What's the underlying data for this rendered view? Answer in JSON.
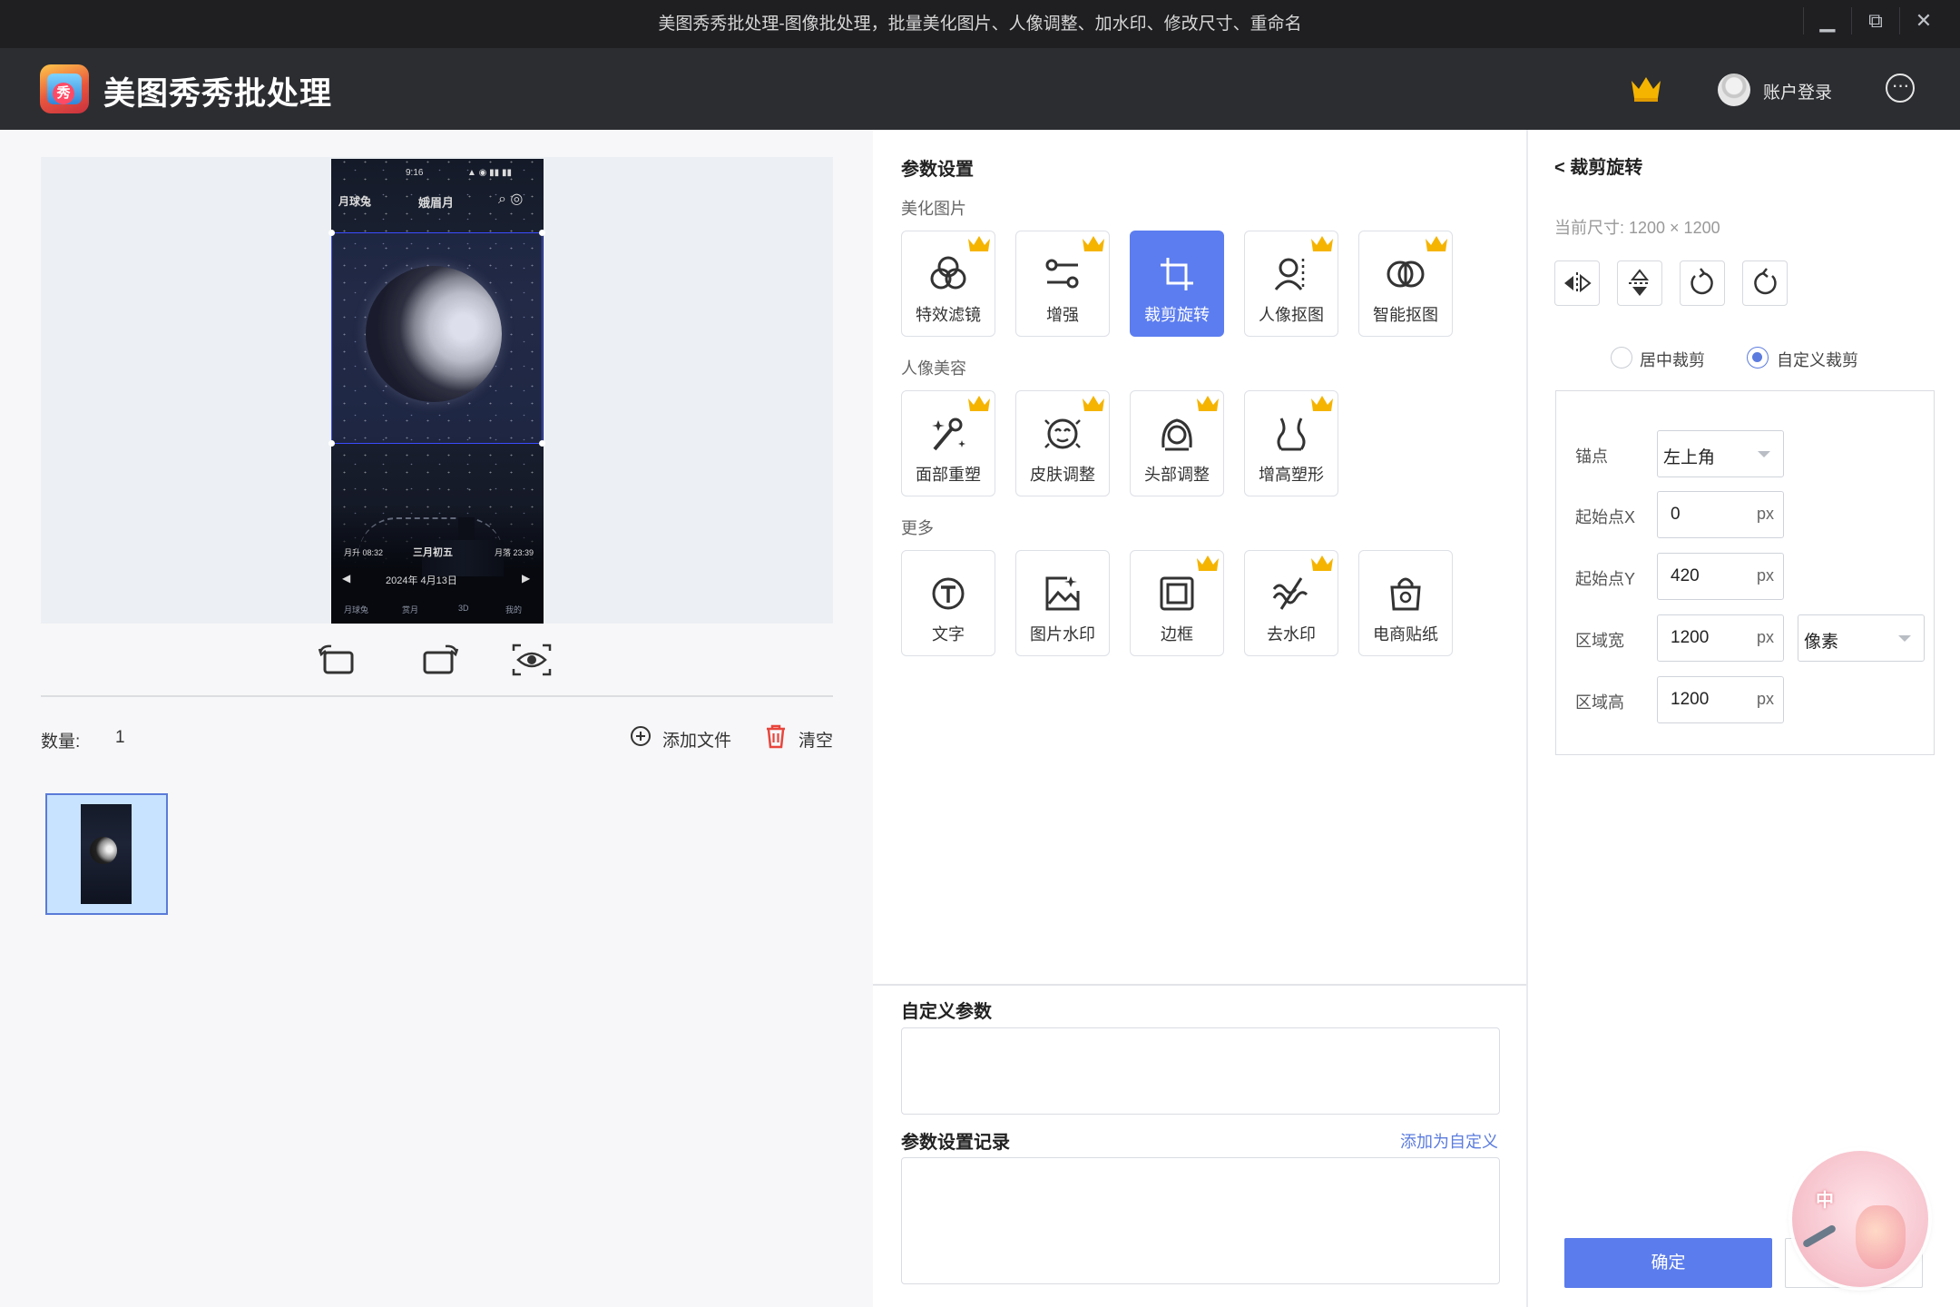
{
  "window": {
    "title": "美图秀秀批处理-图像批处理，批量美化图片、人像调整、加水印、修改尺寸、重命名",
    "controls": [
      "minimize-icon",
      "restore-icon",
      "close-icon"
    ]
  },
  "header": {
    "app_name": "美图秀秀批处理",
    "login_label": "账户登录",
    "logo_glyph": "秀"
  },
  "preview": {
    "phone_status_time": "9:16",
    "phone_tab_1": "月球兔",
    "phone_tab_2": "娥眉月",
    "phone_date": "2024年 4月13日",
    "phone_lunar": "三月初五",
    "phone_rise": "月升 08:32",
    "phone_set": "月落 23:39",
    "phone_nav": [
      "月球兔",
      "赏月",
      "3D",
      "我的"
    ]
  },
  "files": {
    "count_label": "数量:",
    "count_value": "1",
    "add_file_label": "添加文件",
    "clear_label": "清空"
  },
  "params": {
    "section_title": "参数设置",
    "groups": [
      {
        "title": "美化图片",
        "items": [
          {
            "label": "特效滤镜",
            "icon": "filter-icon",
            "vip": true,
            "active": false
          },
          {
            "label": "增强",
            "icon": "slider-icon",
            "vip": true,
            "active": false
          },
          {
            "label": "裁剪旋转",
            "icon": "crop-icon",
            "vip": false,
            "active": true
          },
          {
            "label": "人像抠图",
            "icon": "portrait-cutout-icon",
            "vip": true,
            "active": false
          },
          {
            "label": "智能抠图",
            "icon": "smart-cutout-icon",
            "vip": true,
            "active": false
          }
        ]
      },
      {
        "title": "人像美容",
        "items": [
          {
            "label": "面部重塑",
            "icon": "magic-wand-icon",
            "vip": true,
            "active": false
          },
          {
            "label": "皮肤调整",
            "icon": "face-skin-icon",
            "vip": true,
            "active": false
          },
          {
            "label": "头部调整",
            "icon": "head-icon",
            "vip": true,
            "active": false
          },
          {
            "label": "增高塑形",
            "icon": "body-shape-icon",
            "vip": true,
            "active": false
          }
        ]
      },
      {
        "title": "更多",
        "items": [
          {
            "label": "文字",
            "icon": "text-icon",
            "vip": false,
            "active": false
          },
          {
            "label": "图片水印",
            "icon": "image-watermark-icon",
            "vip": false,
            "active": false
          },
          {
            "label": "边框",
            "icon": "frame-icon",
            "vip": true,
            "active": false
          },
          {
            "label": "去水印",
            "icon": "remove-watermark-icon",
            "vip": true,
            "active": false
          },
          {
            "label": "电商贴纸",
            "icon": "shopping-bag-icon",
            "vip": false,
            "active": false
          }
        ]
      }
    ],
    "custom_title": "自定义参数",
    "history_title": "参数设置记录",
    "add_custom_label": "添加为自定义"
  },
  "crop": {
    "back_label": "< 裁剪旋转",
    "current_size": "当前尺寸:  1200 × 1200",
    "mode_center": "居中裁剪",
    "mode_custom": "自定义裁剪",
    "selected_mode": "custom",
    "anchor_label": "锚点",
    "anchor_value": "左上角",
    "x_label": "起始点X",
    "x_value": "0",
    "y_label": "起始点Y",
    "y_value": "420",
    "w_label": "区域宽",
    "w_value": "1200",
    "h_label": "区域高",
    "h_value": "1200",
    "unit": "px",
    "unit_select": "像素",
    "ok_label": "确定",
    "badge_text": "中"
  },
  "colors": {
    "accent": "#5b7cec",
    "crown": "#f5b400",
    "titlebar": "#1f1f22",
    "header": "#2c2d31"
  }
}
